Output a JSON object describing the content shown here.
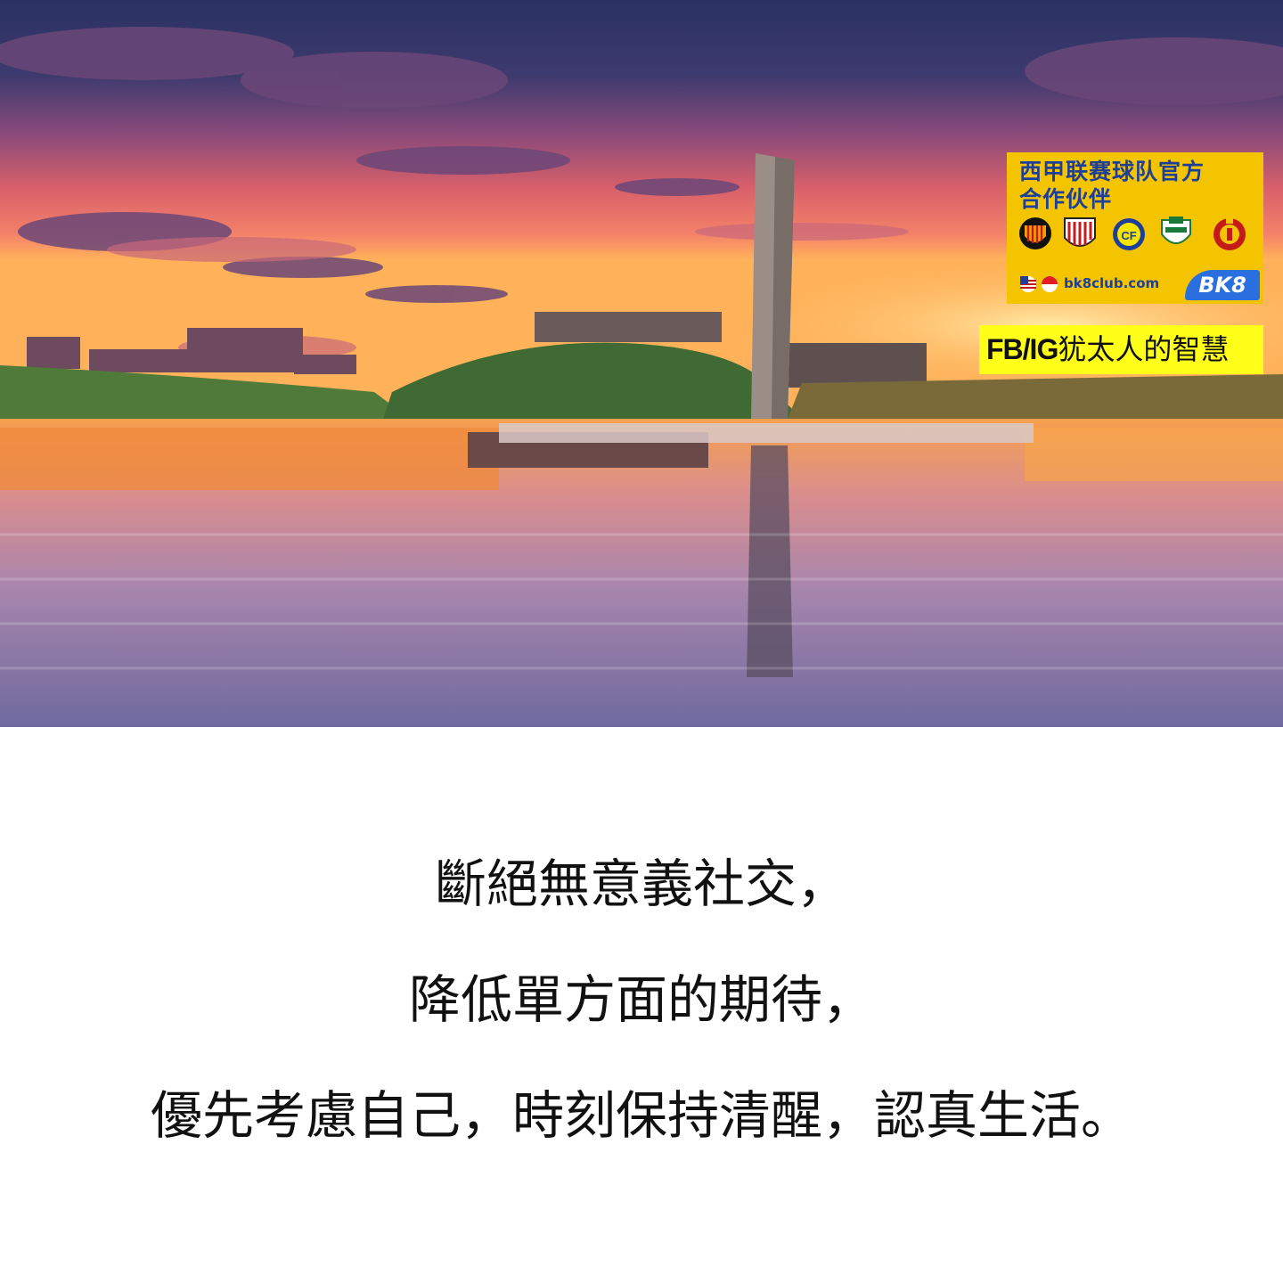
{
  "scene": {
    "colors": {
      "sky_top": "#2e3567",
      "sky_mid": "#8a4a7a",
      "sky_glow": "#f06a5c",
      "horizon": "#ffb25a",
      "water": "#c48aa6"
    }
  },
  "sponsor": {
    "headline_line1": "西甲联赛球队官方",
    "headline_line2": "合作伙伴",
    "url": "bk8club.com",
    "brand": "BK8",
    "crests": [
      "valencia-crest-icon",
      "athletic-crest-icon",
      "villarreal-crest-icon",
      "elche-crest-icon",
      "mallorca-crest-icon"
    ],
    "flags": [
      "malaysia-flag-icon",
      "singapore-flag-icon"
    ],
    "colors": {
      "background": "#f5c400",
      "text": "#1d3f99",
      "logo": "#2a6fe0"
    }
  },
  "social": {
    "handle": "FB/IG",
    "name": "犹太人的智慧",
    "background": "#ffff1a"
  },
  "quote": {
    "lines": [
      "斷絕無意義社交，",
      "降低單方面的期待，",
      "優先考慮自己，時刻保持清醒，認真生活。"
    ]
  }
}
